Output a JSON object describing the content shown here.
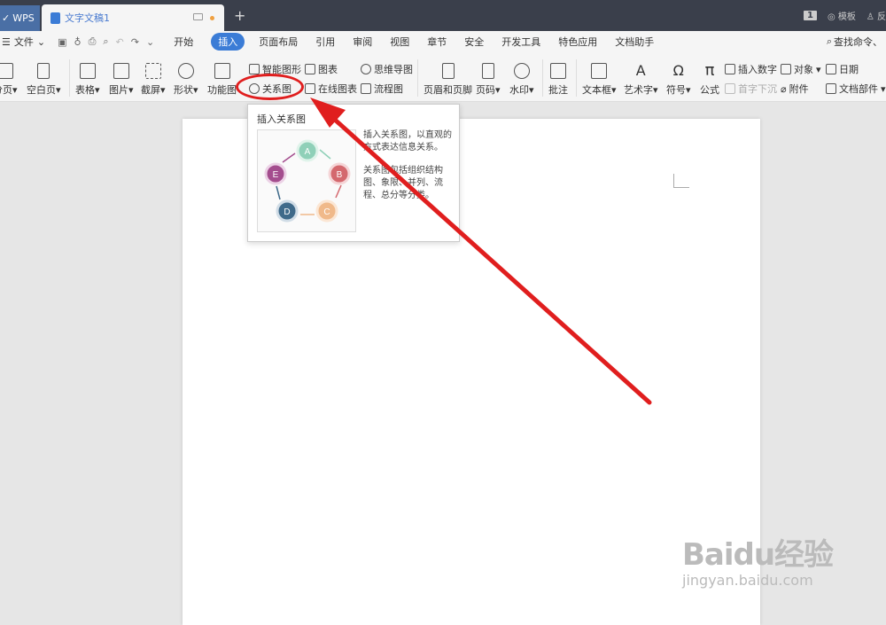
{
  "titlebar": {
    "app_tab": "WPS",
    "doc_tab": "文字文稿1",
    "right_items": [
      "1",
      "模板",
      "反"
    ]
  },
  "menubar": {
    "file": "文件",
    "items": [
      "开始",
      "插入",
      "页面布局",
      "引用",
      "审阅",
      "视图",
      "章节",
      "安全",
      "开发工具",
      "特色应用",
      "文档助手"
    ],
    "active": "插入",
    "search": "查找命令、"
  },
  "toolbar": {
    "page_break": "分页",
    "blank_page": "空白页",
    "table": "表格",
    "picture": "图片",
    "screenshot": "截屏",
    "shape": "形状",
    "function_chart": "功能图",
    "smart_art": "智能图形",
    "relation_chart": "关系图",
    "chart": "图表",
    "online_chart": "在线图表",
    "mind_map": "思维导图",
    "flowchart": "流程图",
    "header_footer": "页眉和页脚",
    "page_number": "页码",
    "watermark": "水印",
    "comment": "批注",
    "text_box": "文本框",
    "word_art": "艺术字",
    "symbol": "符号",
    "formula": "公式",
    "insert_number": "插入数字",
    "drop_cap": "首字下沉",
    "object": "对象",
    "attachment": "附件",
    "date": "日期",
    "doc_parts": "文档部件"
  },
  "tooltip": {
    "title": "插入关系图",
    "desc1": "插入关系图，以直观的方式表达信息关系。",
    "desc2": "关系图包括组织结构图、象限、并列、流程、总分等分类。",
    "nodes": [
      "A",
      "B",
      "C",
      "D",
      "E"
    ]
  },
  "watermark": {
    "big": "Baidu经验",
    "small": "jingyan.baidu.com"
  }
}
